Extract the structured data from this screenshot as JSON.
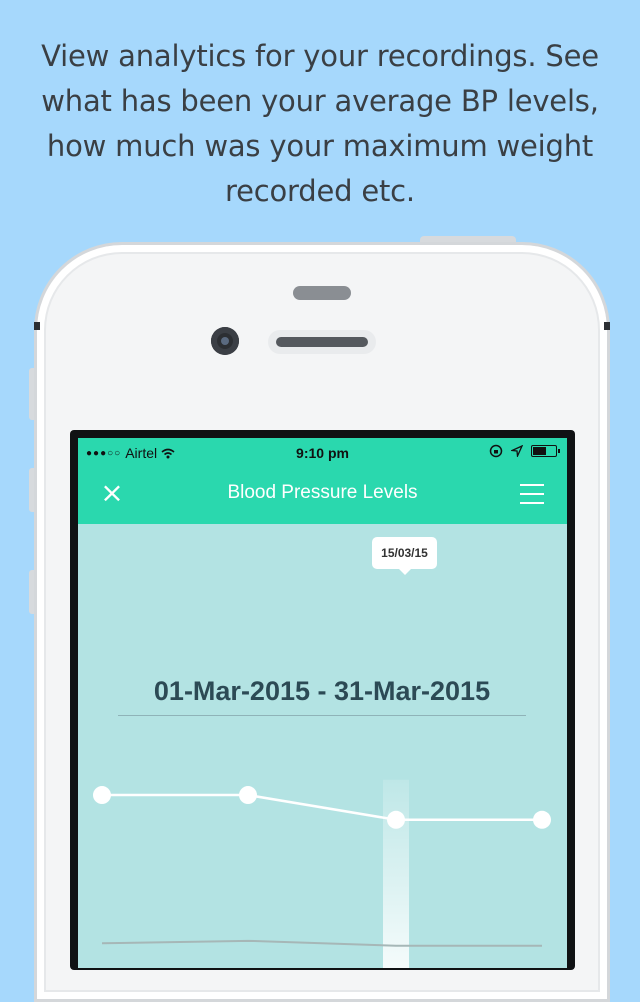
{
  "caption": "View analytics for your recordings. See what has been your average BP levels, how much was your maximum weight recorded etc.",
  "status_bar": {
    "carrier": "Airtel",
    "time": "9:10 pm"
  },
  "navbar": {
    "title": "Blood Pressure Levels",
    "close_icon": "×"
  },
  "tooltip": {
    "label": "15/03/15"
  },
  "date_range": "01-Mar-2015 - 31-Mar-2015",
  "colors": {
    "background": "#a6d8fc",
    "navbar": "#2ad8ae",
    "chart_bg": "#b3e3e3"
  },
  "chart_data": {
    "type": "line",
    "x": [
      "",
      "",
      "15/03/15",
      ""
    ],
    "series": [
      {
        "values": [
          120,
          120,
          110,
          110
        ]
      },
      {
        "values": [
          60,
          61,
          59,
          59
        ]
      }
    ],
    "highlight_index": 2,
    "ylim": [
      50,
      135
    ]
  }
}
